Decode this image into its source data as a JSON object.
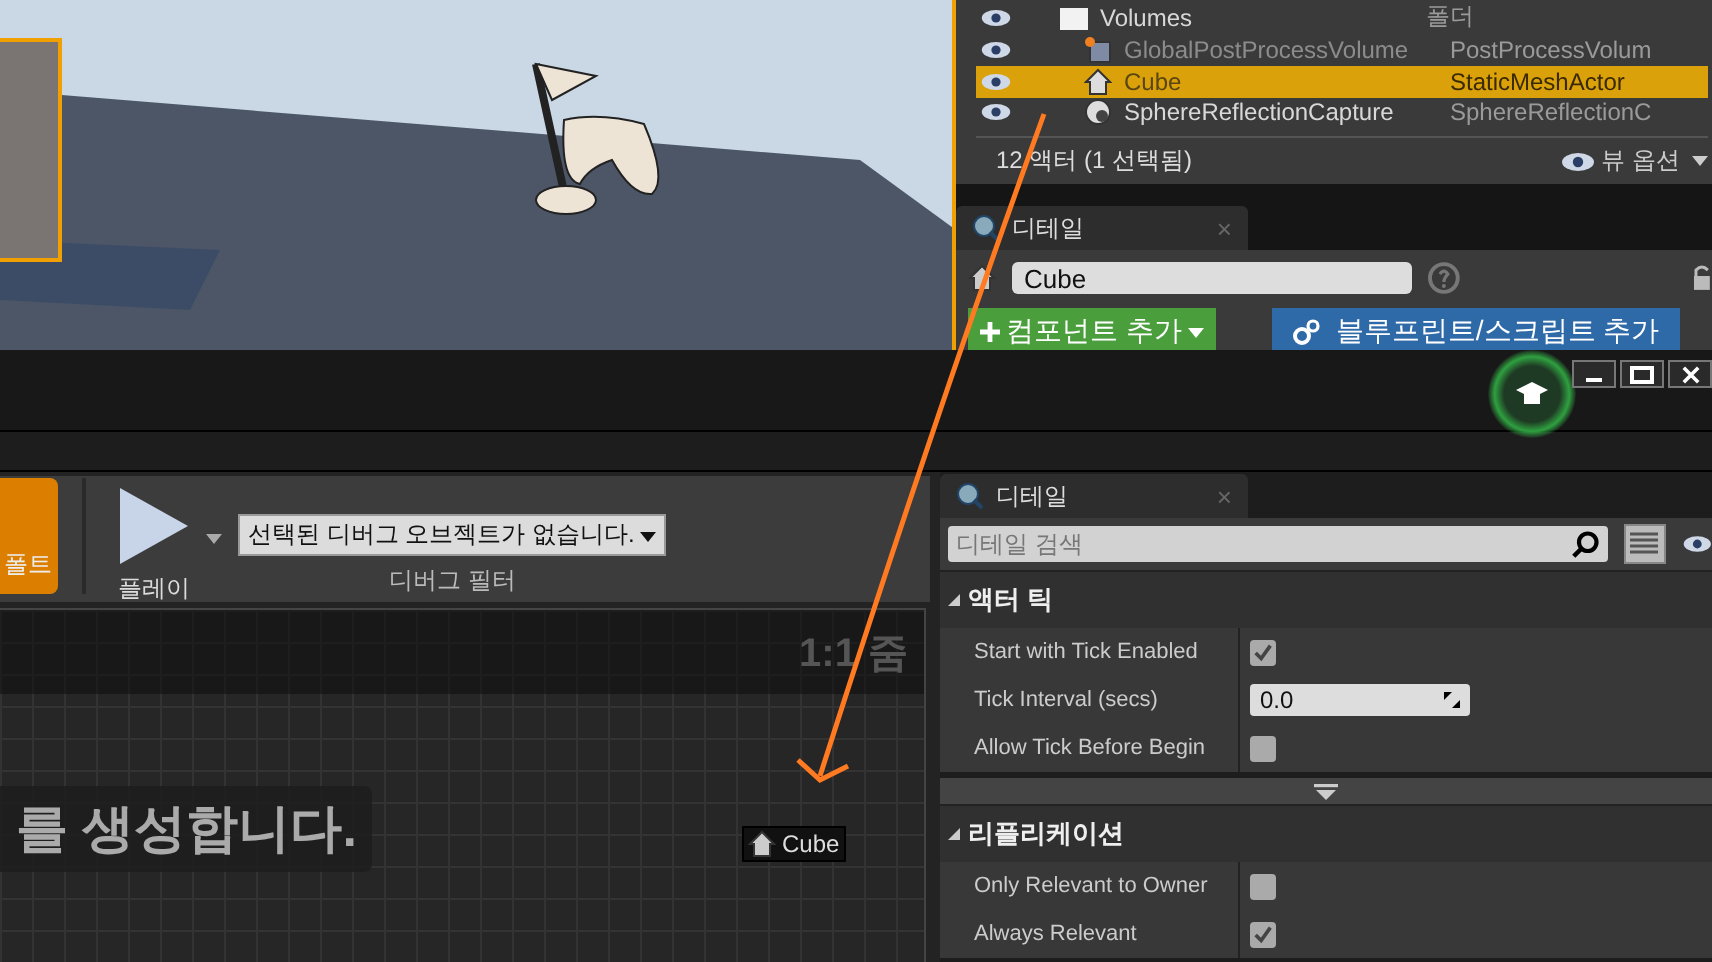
{
  "outliner": {
    "rows": [
      {
        "label": "Volumes",
        "type": "폴더",
        "kind": "folder",
        "selected": false,
        "dimmed": false
      },
      {
        "label": "GlobalPostProcessVolume",
        "type": "PostProcessVolum",
        "kind": "volume",
        "selected": false,
        "dimmed": true
      },
      {
        "label": "Cube",
        "type": "StaticMeshActor",
        "kind": "mesh",
        "selected": true,
        "dimmed": true
      },
      {
        "label": "SphereReflectionCapture",
        "type": "SphereReflectionC",
        "kind": "capture",
        "selected": false,
        "dimmed": false
      }
    ],
    "footer": "12 액터 (1 선택됨)",
    "view_options": "뷰 옵션"
  },
  "top_details": {
    "tab": "디테일",
    "close": "×",
    "name": "Cube",
    "add_component": "컴포넌트 추가",
    "add_blueprint": "블루프린트/스크립트 추가"
  },
  "toolbar": {
    "class_defaults": "폴트",
    "play": "플레이",
    "debug_object": "선택된 디버그 오브젝트가 없습니다.",
    "debug_filter": "디버그 필터"
  },
  "graph": {
    "zoom": "1:1 줌",
    "banner": "를 생성합니다.",
    "node": "Cube"
  },
  "details": {
    "tab": "디테일",
    "close": "×",
    "search_placeholder": "디테일 검색",
    "sections": [
      {
        "title": "액터 틱",
        "rows": [
          {
            "label": "Start with Tick Enabled",
            "kind": "checkbox",
            "checked": true
          },
          {
            "label": "Tick Interval (secs)",
            "kind": "number",
            "value": "0.0"
          },
          {
            "label": "Allow Tick Before Begin",
            "kind": "checkbox",
            "checked": false
          }
        ],
        "advanced": true
      },
      {
        "title": "리플리케이션",
        "rows": [
          {
            "label": "Only Relevant to Owner",
            "kind": "checkbox",
            "checked": false
          },
          {
            "label": "Always Relevant",
            "kind": "checkbox",
            "checked": true
          }
        ]
      }
    ]
  }
}
